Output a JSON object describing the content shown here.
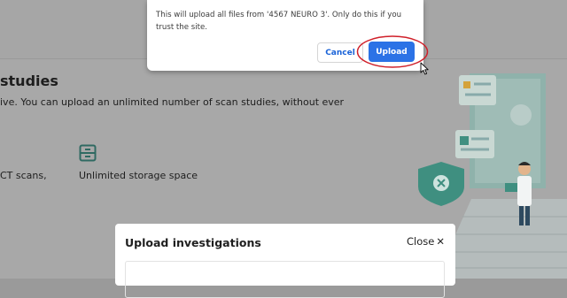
{
  "page": {
    "heading": "studies",
    "description": "ive. You can upload an unlimited number of scan studies, without ever",
    "features": [
      {
        "label": "CT scans,"
      },
      {
        "label": "Unlimited storage space",
        "icon": "storage-icon"
      }
    ]
  },
  "dialog": {
    "message": "This will upload all files from '4567 NEURO 3'. Only do this if you trust the site.",
    "cancel_label": "Cancel",
    "upload_label": "Upload"
  },
  "upload_modal": {
    "title": "Upload investigations",
    "close_label": "Close",
    "close_icon": "close-icon"
  },
  "colors": {
    "primary_button": "#2b72e6",
    "annotation": "#d0202a",
    "illustration_teal": "#3f8f80"
  }
}
